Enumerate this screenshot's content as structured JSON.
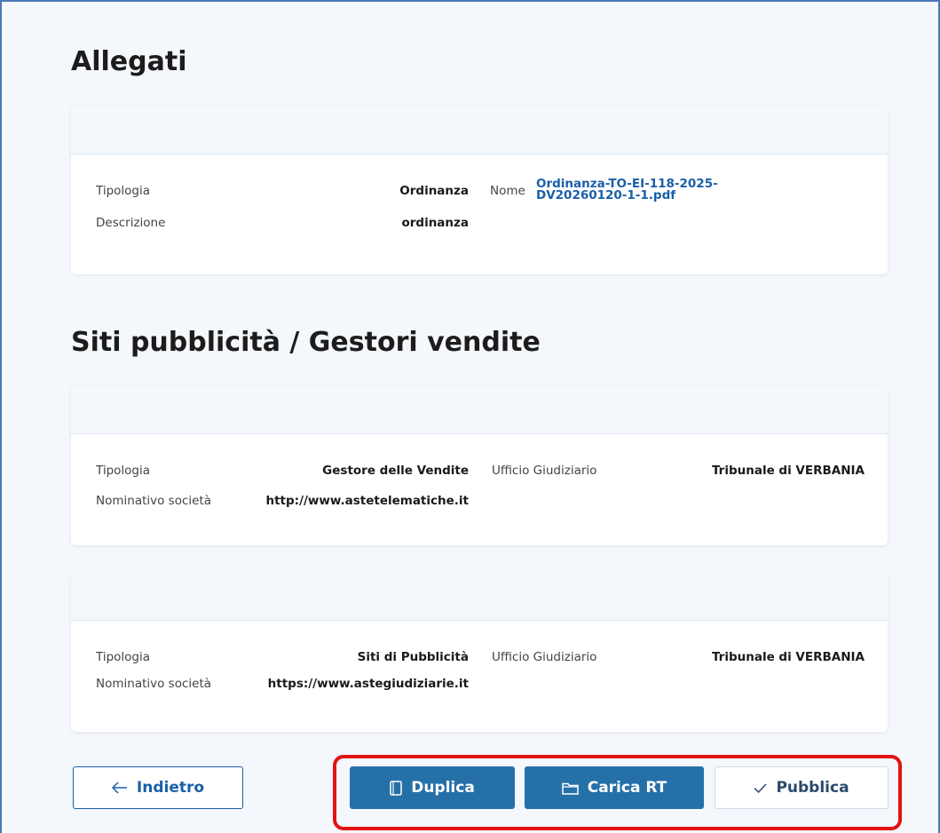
{
  "allegati": {
    "title": "Allegati",
    "tipologia_label": "Tipologia",
    "tipologia_value": "Ordinanza",
    "descrizione_label": "Descrizione",
    "descrizione_value": "ordinanza",
    "nome_label": "Nome",
    "nome_line1": "Ordinanza-TO-EI-118-2025-",
    "nome_line2": "DV20260120-1-1.pdf"
  },
  "siti": {
    "title": "Siti pubblicità / Gestori vendite",
    "cards": [
      {
        "tipologia_label": "Tipologia",
        "tipologia_value": "Gestore delle Vendite",
        "nominativo_label": "Nominativo società",
        "nominativo_value": "http://www.astetelematiche.it",
        "ufficio_label": "Ufficio Giudiziario",
        "ufficio_value": "Tribunale di VERBANIA"
      },
      {
        "tipologia_label": "Tipologia",
        "tipologia_value": "Siti di Pubblicità",
        "nominativo_label": "Nominativo società",
        "nominativo_value": "https://www.astegiudiziarie.it",
        "ufficio_label": "Ufficio Giudiziario",
        "ufficio_value": "Tribunale di VERBANIA"
      }
    ]
  },
  "actions": {
    "back_label": "Indietro",
    "duplica_label": "Duplica",
    "carica_label": "Carica RT",
    "pubblica_label": "Pubblica",
    "back_icon": "arrow-left-icon",
    "duplica_icon": "copy-icon",
    "carica_icon": "folder-icon",
    "pubblica_icon": "check-icon"
  },
  "colors": {
    "primary": "#2670a8",
    "link": "#1a5fa8",
    "highlight": "#e11313"
  }
}
